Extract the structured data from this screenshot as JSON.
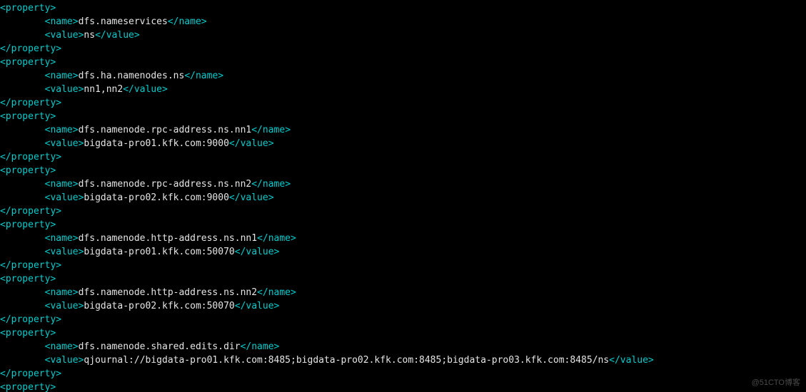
{
  "watermark": "@51CTO博客",
  "lines": [
    {
      "indent": 0,
      "kind": "open",
      "tag": "property"
    },
    {
      "indent": 1,
      "kind": "pair",
      "tag": "name",
      "value": "dfs.nameservices"
    },
    {
      "indent": 1,
      "kind": "pair",
      "tag": "value",
      "value": "ns"
    },
    {
      "indent": 0,
      "kind": "close",
      "tag": "property"
    },
    {
      "indent": 0,
      "kind": "open",
      "tag": "property"
    },
    {
      "indent": 1,
      "kind": "pair",
      "tag": "name",
      "value": "dfs.ha.namenodes.ns"
    },
    {
      "indent": 1,
      "kind": "pair",
      "tag": "value",
      "value": "nn1,nn2"
    },
    {
      "indent": 0,
      "kind": "close",
      "tag": "property"
    },
    {
      "indent": 0,
      "kind": "open",
      "tag": "property"
    },
    {
      "indent": 1,
      "kind": "pair",
      "tag": "name",
      "value": "dfs.namenode.rpc-address.ns.nn1"
    },
    {
      "indent": 1,
      "kind": "pair",
      "tag": "value",
      "value": "bigdata-pro01.kfk.com:9000"
    },
    {
      "indent": 0,
      "kind": "close",
      "tag": "property"
    },
    {
      "indent": 0,
      "kind": "open",
      "tag": "property"
    },
    {
      "indent": 1,
      "kind": "pair",
      "tag": "name",
      "value": "dfs.namenode.rpc-address.ns.nn2"
    },
    {
      "indent": 1,
      "kind": "pair",
      "tag": "value",
      "value": "bigdata-pro02.kfk.com:9000"
    },
    {
      "indent": 0,
      "kind": "close",
      "tag": "property"
    },
    {
      "indent": 0,
      "kind": "open",
      "tag": "property"
    },
    {
      "indent": 1,
      "kind": "pair",
      "tag": "name",
      "value": "dfs.namenode.http-address.ns.nn1"
    },
    {
      "indent": 1,
      "kind": "pair",
      "tag": "value",
      "value": "bigdata-pro01.kfk.com:50070"
    },
    {
      "indent": 0,
      "kind": "close",
      "tag": "property"
    },
    {
      "indent": 0,
      "kind": "open",
      "tag": "property"
    },
    {
      "indent": 1,
      "kind": "pair",
      "tag": "name",
      "value": "dfs.namenode.http-address.ns.nn2"
    },
    {
      "indent": 1,
      "kind": "pair",
      "tag": "value",
      "value": "bigdata-pro02.kfk.com:50070"
    },
    {
      "indent": 0,
      "kind": "close",
      "tag": "property"
    },
    {
      "indent": 0,
      "kind": "open",
      "tag": "property"
    },
    {
      "indent": 1,
      "kind": "pair",
      "tag": "name",
      "value": "dfs.namenode.shared.edits.dir"
    },
    {
      "indent": 1,
      "kind": "pair",
      "tag": "value",
      "value": "qjournal://bigdata-pro01.kfk.com:8485;bigdata-pro02.kfk.com:8485;bigdata-pro03.kfk.com:8485/ns"
    },
    {
      "indent": 0,
      "kind": "close",
      "tag": "property"
    },
    {
      "indent": 0,
      "kind": "open",
      "tag": "property"
    }
  ]
}
